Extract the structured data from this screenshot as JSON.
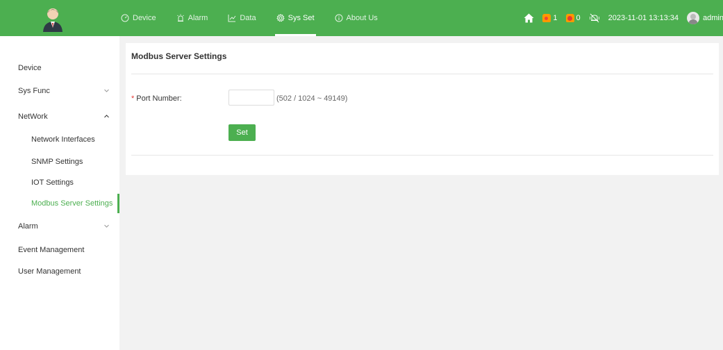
{
  "header": {
    "nav": [
      {
        "label": "Device",
        "icon": "dashboard-icon"
      },
      {
        "label": "Alarm",
        "icon": "alarm-icon"
      },
      {
        "label": "Data",
        "icon": "chart-icon"
      },
      {
        "label": "Sys Set",
        "icon": "gear-icon",
        "active": true
      },
      {
        "label": "About Us",
        "icon": "info-icon"
      }
    ],
    "alarm_count_1": "1",
    "alarm_count_2": "0",
    "datetime": "2023-11-01 13:13:34",
    "username": "admin"
  },
  "sidebar": {
    "items": [
      {
        "label": "Device"
      },
      {
        "label": "Sys Func"
      },
      {
        "label": "NetWork"
      },
      {
        "label": "Network Interfaces"
      },
      {
        "label": "SNMP Settings"
      },
      {
        "label": "IOT Settings"
      },
      {
        "label": "Modbus Server Settings"
      },
      {
        "label": "Alarm"
      },
      {
        "label": "Event Management"
      },
      {
        "label": "User Management"
      }
    ]
  },
  "main": {
    "title": "Modbus Server Settings",
    "port_label": "Port Number",
    "port_colon": ":",
    "required_mark": "*",
    "port_value": "",
    "port_hint": "(502 / 1024 ~ 49149)",
    "set_label": "Set"
  },
  "colors": {
    "accent": "#4caf50",
    "alarm_orange": "#ff9800",
    "alarm_red": "#f44336"
  }
}
